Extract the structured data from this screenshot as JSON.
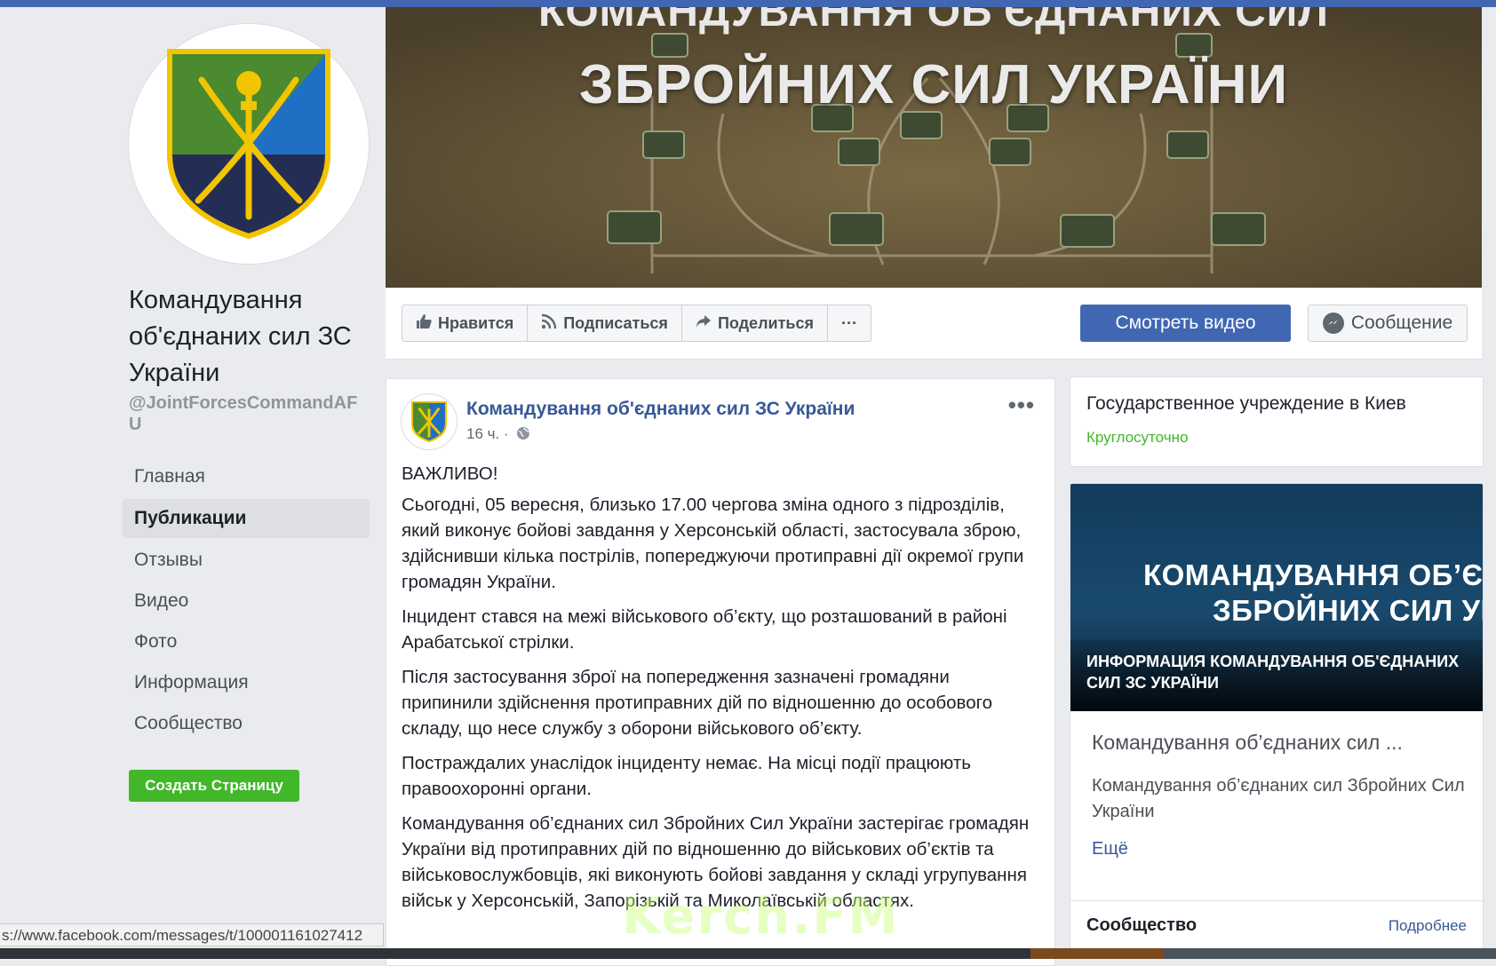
{
  "page": {
    "name": "Командування об'єднаних сил ЗС України",
    "handle": "@JointForcesCommandAFU"
  },
  "nav": {
    "items": [
      "Главная",
      "Публикации",
      "Отзывы",
      "Видео",
      "Фото",
      "Информация",
      "Сообщество"
    ],
    "active_index": 1
  },
  "create_page_label": "Создать Страницу",
  "status_url": "s://www.facebook.com/messages/t/100001161027412",
  "cover": {
    "line1": "КОМАНДУВАННЯ ОБ'ЄДНАНИХ СИЛ",
    "line2": "ЗБРОЙНИХ СИЛ УКРАЇНИ"
  },
  "actions": {
    "like": "Нравится",
    "follow": "Подписаться",
    "share": "Поделиться",
    "more": "···",
    "watch_video": "Смотреть видео",
    "message": "Сообщение"
  },
  "post": {
    "author": "Командування об'єднаних сил ЗС України",
    "time": "16 ч. ·",
    "menu": "•••",
    "paragraphs": [
      "ВАЖЛИВО!",
      "Сьогодні, 05 вересня, близько 17.00 чергова зміна одного з підрозділів, який виконує бойові завдання у Херсонській області, застосувала зброю, здійснивши кілька пострілів, попереджуючи протиправні дії окремої групи громадян України.",
      "Інцидент стався на межі військового об’єкту, що розташований в районі Арабатської стрілки.",
      "Після застосування зброї на попередження зазначені громадяни припинили здійснення протиправних дій по відношенню до особового складу, що несе службу з оборони військового об’єкту.",
      "Постраждалих унаслідок інциденту немає. На місці події працюють правоохоронні органи.",
      "Командування об’єднаних сил Збройних Сил України застерігає громадян України від протиправних дій по відношенню до військових об’єктів та військовослужбовців, які виконують бойові завдання у складі угрупування військ у Херсонській, Запорізькій та Миколаївській областях."
    ]
  },
  "info": {
    "category": "Государственное учреждение в Киев",
    "hours": "Круглосуточно"
  },
  "video": {
    "thumb_line1": "КОМАНДУВАННЯ ОБ’ЄДНАН",
    "thumb_line2": "ЗБРОЙНИХ СИЛ УКР",
    "caption": "ИНФОРМАЦИЯ КОМАНДУВАННЯ ОБ'ЄДНАНИХ СИЛ ЗС УКРАЇНИ",
    "title": "Командування об’єднаних сил ...",
    "description": "Командування об’єднаних сил Збройних Сил України",
    "more": "Ещё"
  },
  "community": {
    "title": "Сообщество",
    "more": "Подробнее"
  },
  "watermark": "Kerch.FM",
  "colors": {
    "brand": "#4267b2",
    "link": "#385898",
    "green": "#42b72a"
  }
}
